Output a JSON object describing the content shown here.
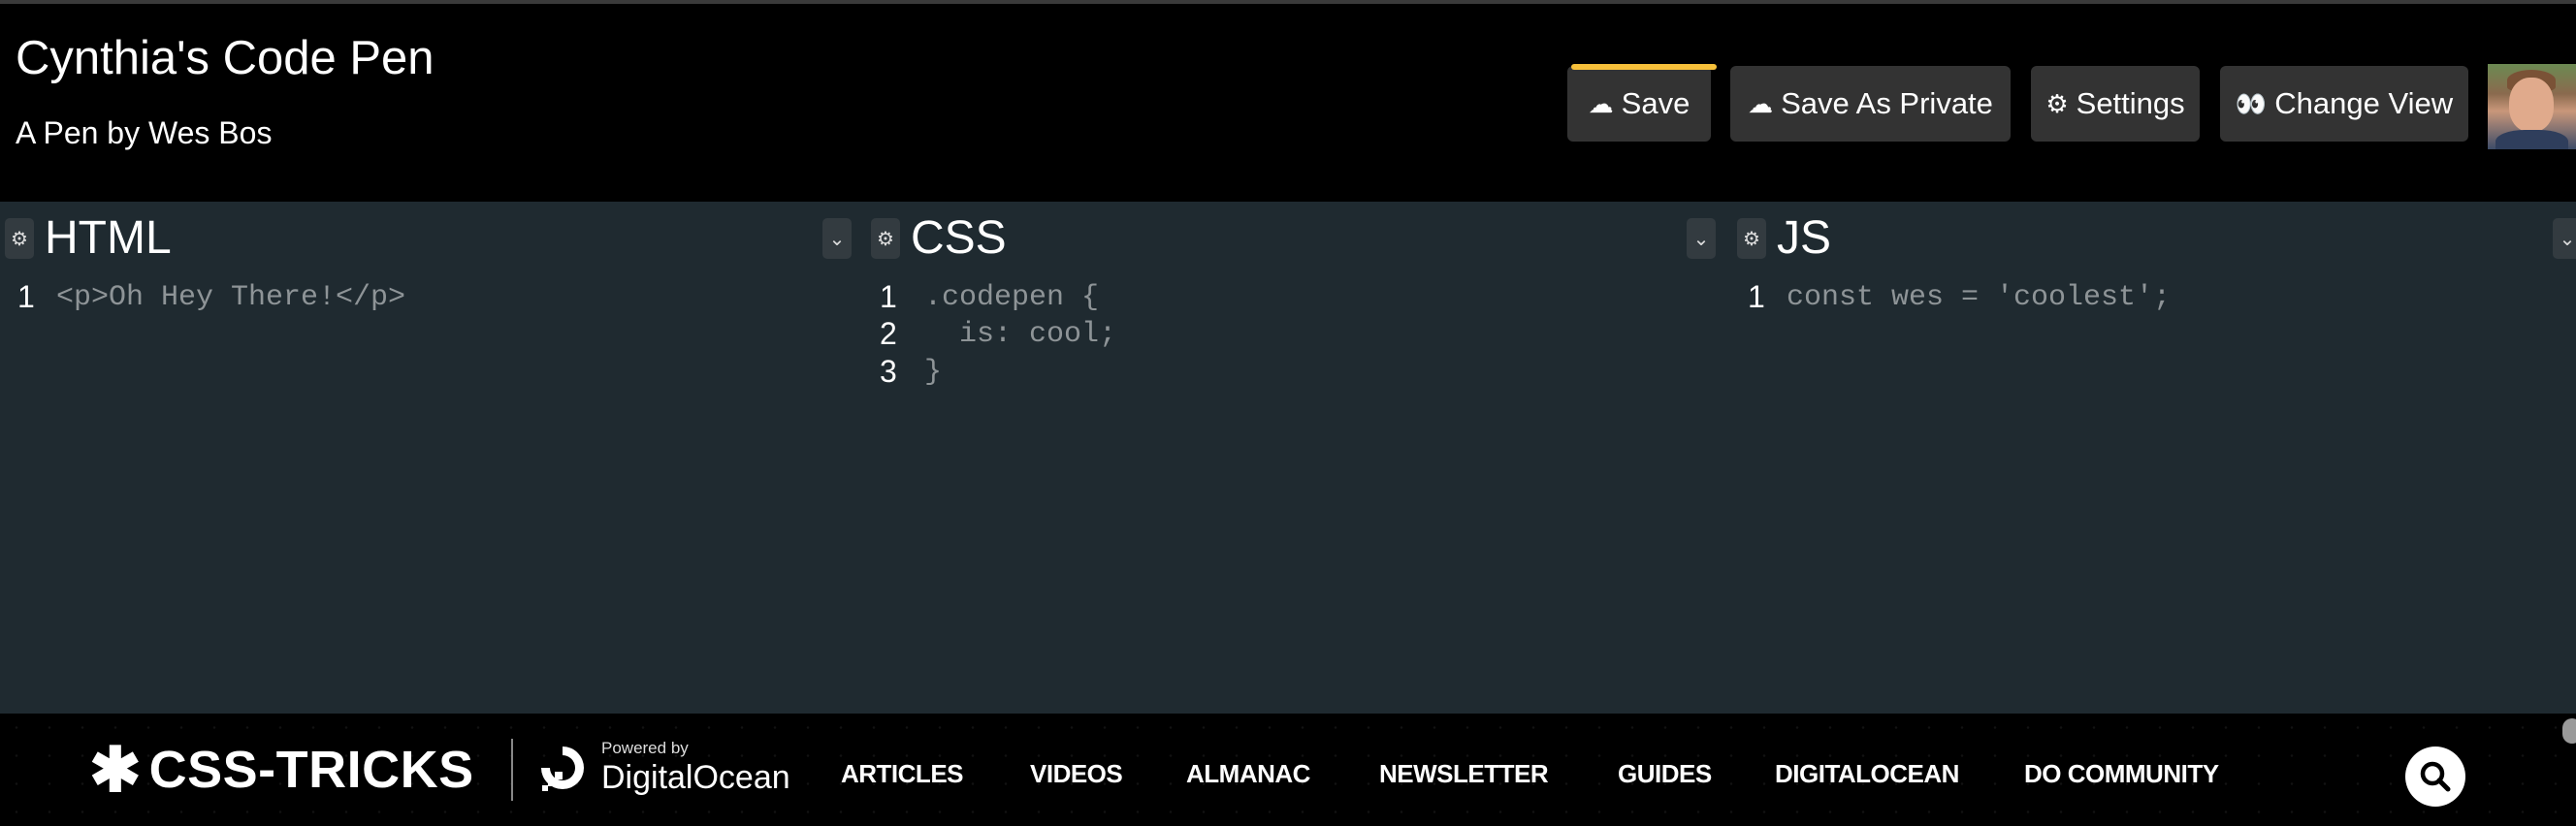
{
  "header": {
    "title": "Cynthia's Code Pen",
    "author": "A Pen by Wes Bos",
    "buttons": {
      "save": {
        "icon": "cloud-icon",
        "glyph": "☁",
        "label": "Save"
      },
      "save_private": {
        "icon": "cloud-icon",
        "glyph": "☁",
        "label": "Save As Private"
      },
      "settings": {
        "icon": "gear-icon",
        "glyph": "⚙",
        "label": "Settings"
      },
      "change_view": {
        "icon": "eyes-icon",
        "glyph": "👀",
        "label": "Change View"
      }
    },
    "save_accent": "#f6c03a"
  },
  "editors": {
    "html": {
      "title": "HTML",
      "lines": [
        {
          "num": "1",
          "text": "<p>Oh Hey There!</p>"
        }
      ]
    },
    "css": {
      "title": "CSS",
      "lines": [
        {
          "num": "1",
          "text": ".codepen {"
        },
        {
          "num": "2",
          "text": "  is: cool;"
        },
        {
          "num": "3",
          "text": "}"
        }
      ]
    },
    "js": {
      "title": "JS",
      "lines": [
        {
          "num": "1",
          "text": "const wes = 'coolest';"
        }
      ]
    },
    "gear_glyph": "⚙",
    "chevron_glyph": "⌄",
    "background": "#1f2a30"
  },
  "footer": {
    "logo_star": "✱",
    "logo_text": "CSS-TRICKS",
    "powered_by": "Powered by",
    "sponsor": "DigitalOcean",
    "nav": [
      "ARTICLES",
      "VIDEOS",
      "ALMANAC",
      "NEWSLETTER",
      "GUIDES",
      "DIGITALOCEAN",
      "DO COMMUNITY"
    ]
  }
}
